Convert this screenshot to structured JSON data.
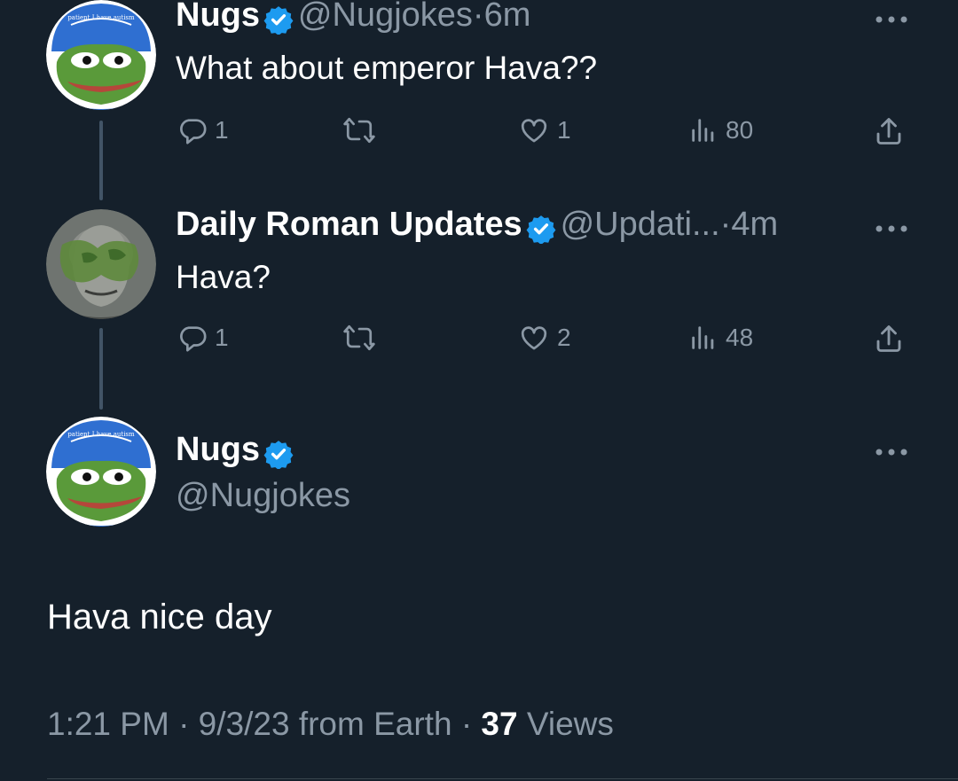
{
  "tweets": [
    {
      "name": "Nugs",
      "handle": "@Nugjokes",
      "separator": "·",
      "time": "6m",
      "text": "What about emperor Hava??",
      "replies": "1",
      "likes": "1",
      "views": "80"
    },
    {
      "name": "Daily Roman Updates",
      "handle": "@Updati...",
      "separator": "·",
      "time": "4m",
      "text": "Hava?",
      "replies": "1",
      "likes": "2",
      "views": "48"
    }
  ],
  "main_tweet": {
    "name": "Nugs",
    "handle": "@Nugjokes",
    "text": "Hava nice day",
    "timestamp": "1:21 PM · 9/3/23 from Earth ·",
    "views_count": "37",
    "views_label": "Views"
  },
  "avatar_caption": "patient I have autism",
  "icons": {
    "reply": "reply-icon",
    "retweet": "retweet-icon",
    "like": "heart-icon",
    "views": "views-icon",
    "share": "share-icon",
    "more": "more-icon",
    "verified": "verified-badge-icon"
  },
  "colors": {
    "background": "#15202b",
    "muted": "#8b98a5",
    "verified": "#1d9bf0"
  }
}
